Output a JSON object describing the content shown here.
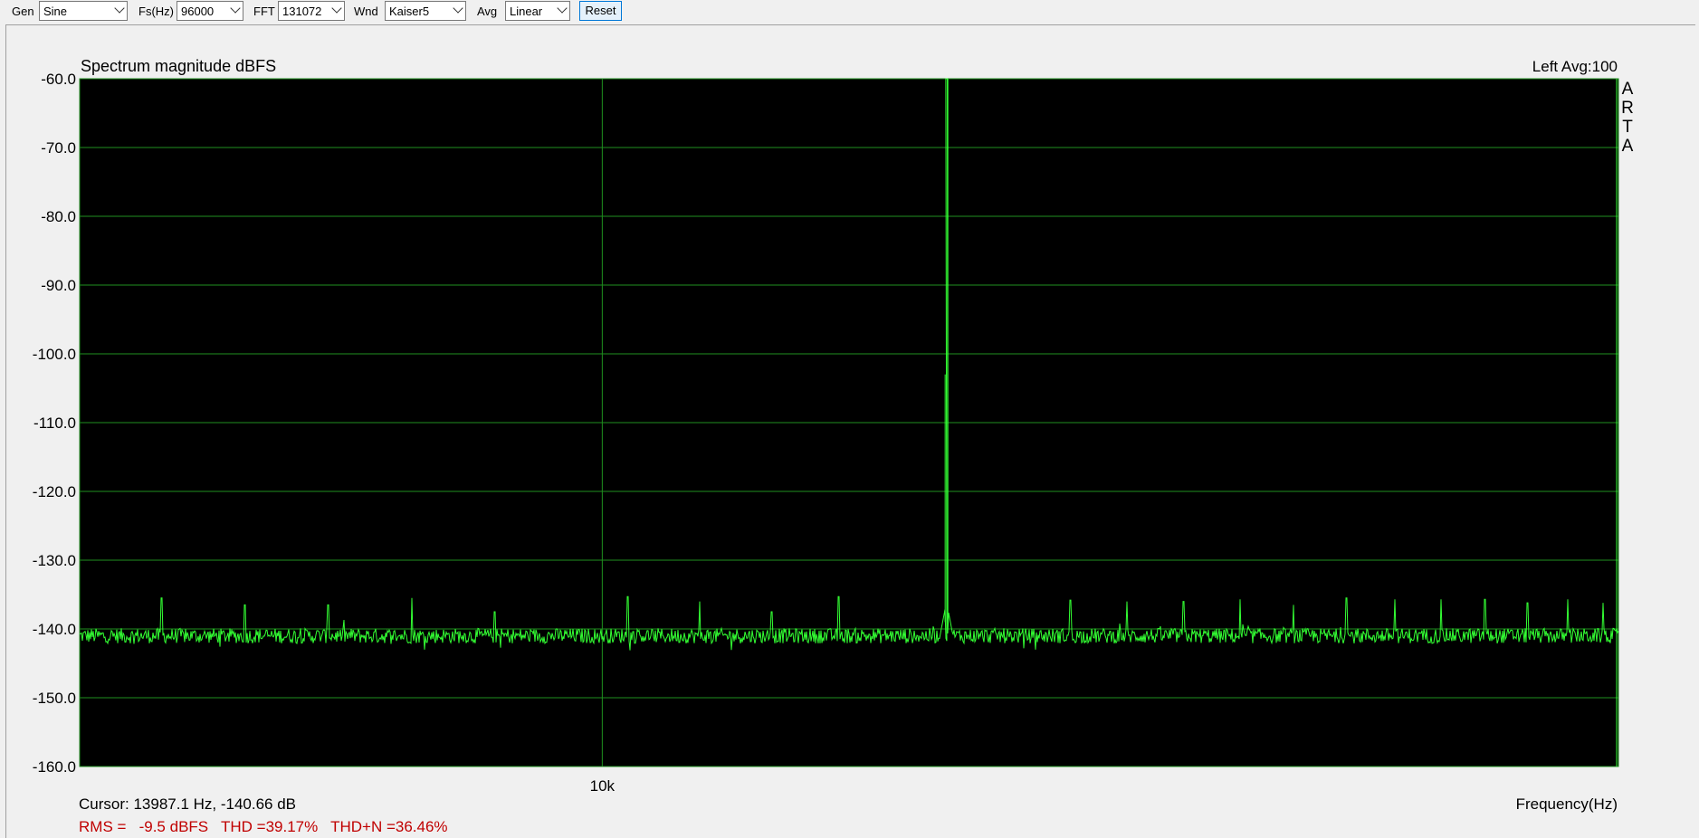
{
  "toolbar": {
    "gen": {
      "label": "Gen",
      "value": "Sine"
    },
    "fs": {
      "label": "Fs(Hz)",
      "value": "96000"
    },
    "fft": {
      "label": "FFT",
      "value": "131072"
    },
    "wnd": {
      "label": "Wnd",
      "value": "Kaiser5"
    },
    "avg": {
      "label": "Avg",
      "value": "Linear"
    },
    "reset_label": "Reset"
  },
  "plot": {
    "title": "Spectrum magnitude dBFS",
    "channel_info": "Left  Avg:100",
    "logo_letters": [
      "A",
      "R",
      "T",
      "A"
    ],
    "cursor_readout": "Cursor: 13987.1 Hz, -140.66 dB",
    "stats_readout": "RMS =   -9.5 dBFS   THD =39.17%   THD+N =36.46%",
    "xlabel": "Frequency(Hz)"
  },
  "colors": {
    "plot_background": "#000000",
    "grid": "#1f8f1f",
    "trace": "#33ff33",
    "stats_text": "#c00000"
  },
  "chart_data": {
    "type": "line",
    "title": "Spectrum magnitude dBFS",
    "xlabel": "Frequency(Hz)",
    "ylabel": "",
    "x_scale": "log",
    "xlim": [
      6000,
      27000
    ],
    "ylim": [
      -160,
      -60
    ],
    "y_ticks": [
      "-60.0",
      "-70.0",
      "-80.0",
      "-90.0",
      "-100.0",
      "-110.0",
      "-120.0",
      "-130.0",
      "-140.0",
      "-150.0",
      "-160.0"
    ],
    "x_ticks": [
      {
        "value": 10000,
        "label": "10k"
      }
    ],
    "grid": true,
    "noise_floor_db": -141,
    "series": [
      {
        "fundamental": {
          "frequency": 14000,
          "level": -60
        },
        "spurs": [
          {
            "frequency": 6500,
            "level": -135.5
          },
          {
            "frequency": 7050,
            "level": -136.5
          },
          {
            "frequency": 7650,
            "level": -136.5
          },
          {
            "frequency": 8300,
            "level": -135.5
          },
          {
            "frequency": 9000,
            "level": -137.5
          },
          {
            "frequency": 10250,
            "level": -135.3
          },
          {
            "frequency": 11000,
            "level": -136
          },
          {
            "frequency": 11800,
            "level": -137.5
          },
          {
            "frequency": 12600,
            "level": -135.3
          },
          {
            "frequency": 15800,
            "level": -135.8
          },
          {
            "frequency": 16700,
            "level": -136
          },
          {
            "frequency": 17650,
            "level": -136
          },
          {
            "frequency": 18650,
            "level": -135.7
          },
          {
            "frequency": 19650,
            "level": -136.5
          },
          {
            "frequency": 20700,
            "level": -135.5
          },
          {
            "frequency": 21700,
            "level": -135.7
          },
          {
            "frequency": 22700,
            "level": -135.7
          },
          {
            "frequency": 23700,
            "level": -135.7
          },
          {
            "frequency": 24700,
            "level": -136.2
          },
          {
            "frequency": 25700,
            "level": -135.7
          },
          {
            "frequency": 26600,
            "level": -136.2
          }
        ]
      }
    ]
  }
}
